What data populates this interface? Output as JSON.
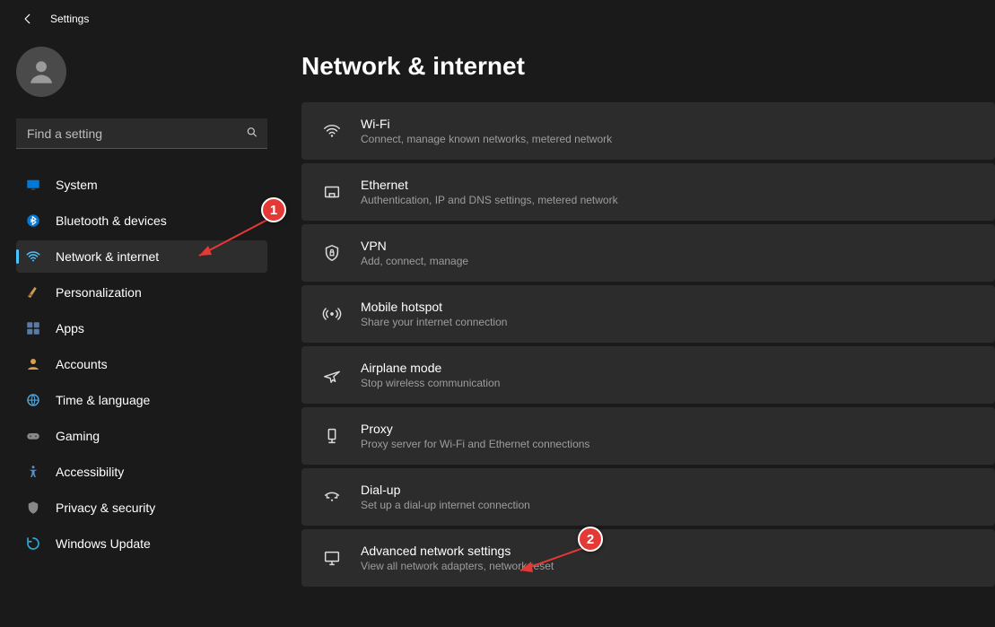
{
  "app": {
    "title": "Settings"
  },
  "search": {
    "placeholder": "Find a setting"
  },
  "sidebar": {
    "items": [
      {
        "label": "System"
      },
      {
        "label": "Bluetooth & devices"
      },
      {
        "label": "Network & internet"
      },
      {
        "label": "Personalization"
      },
      {
        "label": "Apps"
      },
      {
        "label": "Accounts"
      },
      {
        "label": "Time & language"
      },
      {
        "label": "Gaming"
      },
      {
        "label": "Accessibility"
      },
      {
        "label": "Privacy & security"
      },
      {
        "label": "Windows Update"
      }
    ],
    "active_index": 2
  },
  "page": {
    "title": "Network & internet",
    "cards": [
      {
        "title": "Wi-Fi",
        "sub": "Connect, manage known networks, metered network"
      },
      {
        "title": "Ethernet",
        "sub": "Authentication, IP and DNS settings, metered network"
      },
      {
        "title": "VPN",
        "sub": "Add, connect, manage"
      },
      {
        "title": "Mobile hotspot",
        "sub": "Share your internet connection"
      },
      {
        "title": "Airplane mode",
        "sub": "Stop wireless communication"
      },
      {
        "title": "Proxy",
        "sub": "Proxy server for Wi-Fi and Ethernet connections"
      },
      {
        "title": "Dial-up",
        "sub": "Set up a dial-up internet connection"
      },
      {
        "title": "Advanced network settings",
        "sub": "View all network adapters, network reset"
      }
    ]
  },
  "annotations": {
    "marker1": "1",
    "marker2": "2"
  }
}
